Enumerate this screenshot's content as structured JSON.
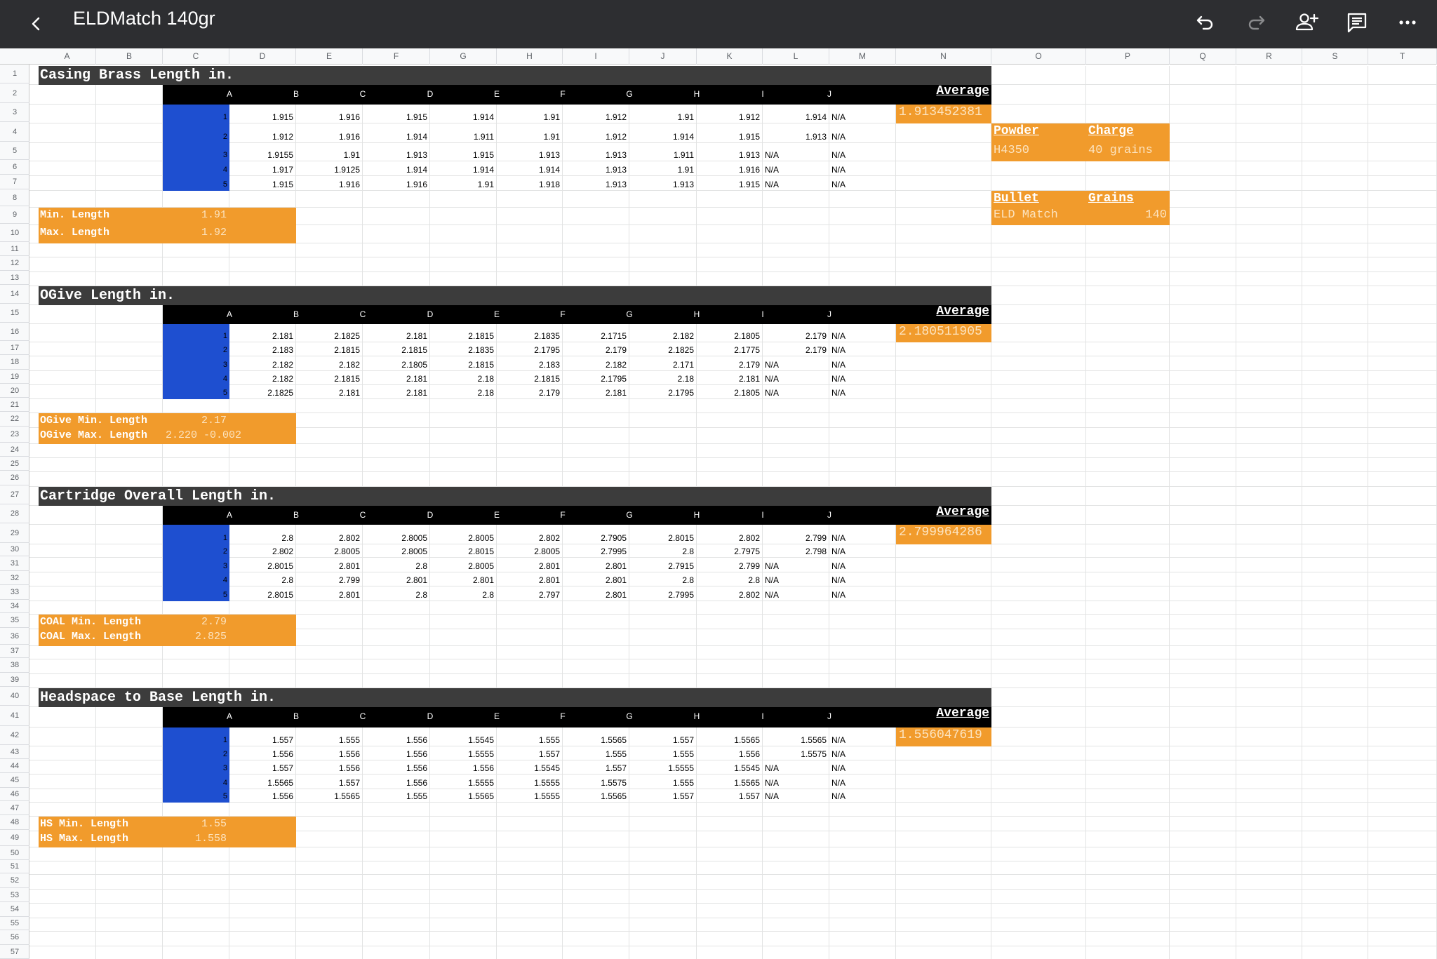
{
  "topbar": {
    "title": "ELDMatch 140gr",
    "icons": [
      "back-icon",
      "undo-icon",
      "redo-icon",
      "add-person-icon",
      "comments-icon",
      "more-icon"
    ]
  },
  "columns": [
    "A",
    "B",
    "C",
    "D",
    "E",
    "F",
    "G",
    "H",
    "I",
    "J",
    "K",
    "L",
    "M",
    "N",
    "O",
    "P",
    "Q",
    "R",
    "S",
    "T"
  ],
  "rows": [
    "1",
    "2",
    "3",
    "4",
    "5",
    "6",
    "7",
    "8",
    "9",
    "10",
    "11",
    "12",
    "13",
    "14",
    "15",
    "16",
    "17",
    "18",
    "19",
    "20",
    "21",
    "22",
    "23",
    "24",
    "25",
    "26",
    "27",
    "28",
    "29",
    "30",
    "31",
    "32",
    "33",
    "34",
    "35",
    "36",
    "37",
    "38",
    "39",
    "40",
    "41",
    "42",
    "43",
    "44",
    "45",
    "46",
    "47",
    "48",
    "49",
    "50",
    "51",
    "52",
    "53",
    "54",
    "55",
    "56",
    "57"
  ],
  "table_col_labels": [
    "A",
    "B",
    "C",
    "D",
    "E",
    "F",
    "G",
    "H",
    "I",
    "J"
  ],
  "average_label": "Average",
  "colors": {
    "topbar": "#2d2e31",
    "section_header": "#3c3c3c",
    "orange": "#f19b2c",
    "blue": "#1e4fd0"
  },
  "sections": [
    {
      "title": "Casing Brass Length in.",
      "average": "1.913452381",
      "data": [
        [
          "1",
          "1.915",
          "1.916",
          "1.915",
          "1.914",
          "1.91",
          "1.912",
          "1.91",
          "1.912",
          "1.914",
          "N/A"
        ],
        [
          "2",
          "1.912",
          "1.916",
          "1.914",
          "1.911",
          "1.91",
          "1.912",
          "1.914",
          "1.915",
          "1.913",
          "N/A"
        ],
        [
          "3",
          "1.9155",
          "1.91",
          "1.913",
          "1.915",
          "1.913",
          "1.913",
          "1.911",
          "1.913",
          "N/A",
          "N/A"
        ],
        [
          "4",
          "1.917",
          "1.9125",
          "1.914",
          "1.914",
          "1.914",
          "1.913",
          "1.91",
          "1.916",
          "N/A",
          "N/A"
        ],
        [
          "5",
          "1.915",
          "1.916",
          "1.916",
          "1.91",
          "1.918",
          "1.913",
          "1.913",
          "1.915",
          "N/A",
          "N/A"
        ]
      ],
      "limits": [
        {
          "label": "Min. Length",
          "value": "1.91"
        },
        {
          "label": "Max. Length",
          "value": "1.92"
        }
      ]
    },
    {
      "title": "OGive Length in.",
      "average": "2.180511905",
      "data": [
        [
          "1",
          "2.181",
          "2.1825",
          "2.181",
          "2.1815",
          "2.1835",
          "2.1715",
          "2.182",
          "2.1805",
          "2.179",
          "N/A"
        ],
        [
          "2",
          "2.183",
          "2.1815",
          "2.1815",
          "2.1835",
          "2.1795",
          "2.179",
          "2.1825",
          "2.1775",
          "2.179",
          "N/A"
        ],
        [
          "3",
          "2.182",
          "2.182",
          "2.1805",
          "2.1815",
          "2.183",
          "2.182",
          "2.171",
          "2.179",
          "N/A",
          "N/A"
        ],
        [
          "4",
          "2.182",
          "2.1815",
          "2.181",
          "2.18",
          "2.1815",
          "2.1795",
          "2.18",
          "2.181",
          "N/A",
          "N/A"
        ],
        [
          "5",
          "2.1825",
          "2.181",
          "2.181",
          "2.18",
          "2.179",
          "2.181",
          "2.1795",
          "2.1805",
          "N/A",
          "N/A"
        ]
      ],
      "limits": [
        {
          "label": "OGive Min. Length",
          "value": "2.17"
        },
        {
          "label": "OGive Max. Length",
          "value": "2.220 -0.002"
        }
      ]
    },
    {
      "title": "Cartridge Overall Length in.",
      "average": "2.799964286",
      "data": [
        [
          "1",
          "2.8",
          "2.802",
          "2.8005",
          "2.8005",
          "2.802",
          "2.7905",
          "2.8015",
          "2.802",
          "2.799",
          "N/A"
        ],
        [
          "2",
          "2.802",
          "2.8005",
          "2.8005",
          "2.8015",
          "2.8005",
          "2.7995",
          "2.8",
          "2.7975",
          "2.798",
          "N/A"
        ],
        [
          "3",
          "2.8015",
          "2.801",
          "2.8",
          "2.8005",
          "2.801",
          "2.801",
          "2.7915",
          "2.799",
          "N/A",
          "N/A"
        ],
        [
          "4",
          "2.8",
          "2.799",
          "2.801",
          "2.801",
          "2.801",
          "2.801",
          "2.8",
          "2.8",
          "N/A",
          "N/A"
        ],
        [
          "5",
          "2.8015",
          "2.801",
          "2.8",
          "2.8",
          "2.797",
          "2.801",
          "2.7995",
          "2.802",
          "N/A",
          "N/A"
        ]
      ],
      "limits": [
        {
          "label": "COAL Min. Length",
          "value": "2.79"
        },
        {
          "label": "COAL Max. Length",
          "value": "2.825"
        }
      ]
    },
    {
      "title": "Headspace to Base Length in.",
      "average": "1.556047619",
      "data": [
        [
          "1",
          "1.557",
          "1.555",
          "1.556",
          "1.5545",
          "1.555",
          "1.5565",
          "1.557",
          "1.5565",
          "1.5565",
          "N/A"
        ],
        [
          "2",
          "1.556",
          "1.556",
          "1.556",
          "1.5555",
          "1.557",
          "1.555",
          "1.555",
          "1.556",
          "1.5575",
          "N/A"
        ],
        [
          "3",
          "1.557",
          "1.556",
          "1.556",
          "1.556",
          "1.5545",
          "1.557",
          "1.5555",
          "1.5545",
          "N/A",
          "N/A"
        ],
        [
          "4",
          "1.5565",
          "1.557",
          "1.556",
          "1.5555",
          "1.5555",
          "1.5575",
          "1.555",
          "1.5565",
          "N/A",
          "N/A"
        ],
        [
          "5",
          "1.556",
          "1.5565",
          "1.555",
          "1.5565",
          "1.5555",
          "1.5565",
          "1.557",
          "1.557",
          "N/A",
          "N/A"
        ]
      ],
      "limits": [
        {
          "label": "HS Min. Length",
          "value": "1.55"
        },
        {
          "label": "HS Max. Length",
          "value": "1.558"
        }
      ]
    }
  ],
  "load_info": {
    "powder_label": "Powder",
    "charge_label": "Charge",
    "powder": "H4350",
    "charge": "40 grains",
    "bullet_label": "Bullet",
    "grains_label": "Grains",
    "bullet": "ELD Match",
    "grains": "140"
  }
}
